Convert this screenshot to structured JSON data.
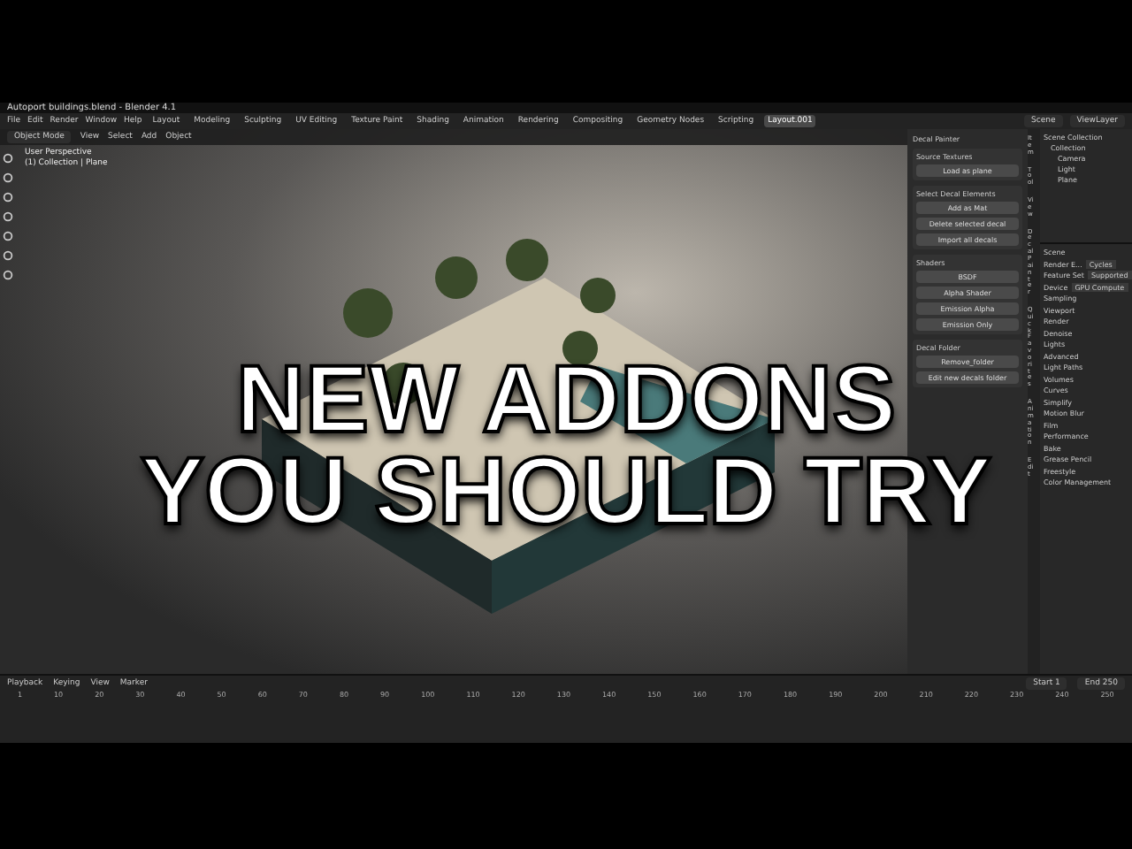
{
  "window": {
    "title": "Autoport buildings.blend - Blender 4.1"
  },
  "menu": [
    "File",
    "Edit",
    "Render",
    "Window",
    "Help"
  ],
  "workspaces": [
    {
      "label": "Layout",
      "selected": false
    },
    {
      "label": "Modeling",
      "selected": false
    },
    {
      "label": "Sculpting",
      "selected": false
    },
    {
      "label": "UV Editing",
      "selected": false
    },
    {
      "label": "Texture Paint",
      "selected": false
    },
    {
      "label": "Shading",
      "selected": false
    },
    {
      "label": "Animation",
      "selected": false
    },
    {
      "label": "Rendering",
      "selected": false
    },
    {
      "label": "Compositing",
      "selected": false
    },
    {
      "label": "Geometry Nodes",
      "selected": false
    },
    {
      "label": "Scripting",
      "selected": false
    },
    {
      "label": "Layout.001",
      "selected": true
    }
  ],
  "scene_field": "Scene",
  "view_layer_field": "ViewLayer",
  "viewport": {
    "mode": "Object Mode",
    "menu": [
      "View",
      "Select",
      "Add",
      "Object"
    ],
    "info": [
      "User Perspective",
      "(1) Collection | Plane"
    ]
  },
  "side_panel": {
    "header": "Decal Painter",
    "sections": [
      {
        "title": "Source Textures",
        "buttons": [
          "Load as plane"
        ]
      },
      {
        "title": "Select Decal Elements",
        "buttons": [
          "Add as Mat",
          "Delete selected decal",
          "Import all decals"
        ]
      },
      {
        "title": "Shaders",
        "buttons": [
          "BSDF",
          "Alpha Shader",
          "Emission Alpha",
          "Emission Only"
        ]
      },
      {
        "title": "Decal Folder",
        "buttons": [
          "Remove_folder",
          "Edit new decals folder"
        ]
      }
    ],
    "tabs": [
      "Item",
      "Tool",
      "View",
      "Decal Painter",
      "Quick Favorites",
      "Animation",
      "Edit"
    ]
  },
  "outliner": {
    "root": "Scene Collection",
    "children": [
      {
        "label": "Collection",
        "children": [
          {
            "label": "Camera"
          },
          {
            "label": "Light"
          },
          {
            "label": "Plane"
          }
        ]
      }
    ]
  },
  "properties": {
    "title": "Scene",
    "fields": [
      {
        "label": "Render E...",
        "value": "Cycles"
      },
      {
        "label": "Feature Set",
        "value": "Supported"
      },
      {
        "label": "Device",
        "value": "GPU Compute"
      }
    ],
    "sections": [
      "Sampling",
      "Viewport",
      "Render",
      "Denoise",
      "Lights",
      "Advanced",
      "Light Paths",
      "Volumes",
      "Curves",
      "Simplify",
      "Motion Blur",
      "Film",
      "Performance",
      "Bake",
      "Grease Pencil",
      "Freestyle",
      "Color Management"
    ]
  },
  "timeline": {
    "menu": [
      "Playback",
      "Keying",
      "View",
      "Marker"
    ],
    "frames": [
      "1",
      "10",
      "20",
      "30",
      "40",
      "50",
      "60",
      "70",
      "80",
      "90",
      "100",
      "110",
      "120",
      "130",
      "140",
      "150",
      "160",
      "170",
      "180",
      "190",
      "200",
      "210",
      "220",
      "230",
      "240",
      "250"
    ],
    "start": "Start 1",
    "end": "End 250"
  },
  "headline": [
    "NEW ADDONS",
    "YOU SHOULD TRY"
  ]
}
